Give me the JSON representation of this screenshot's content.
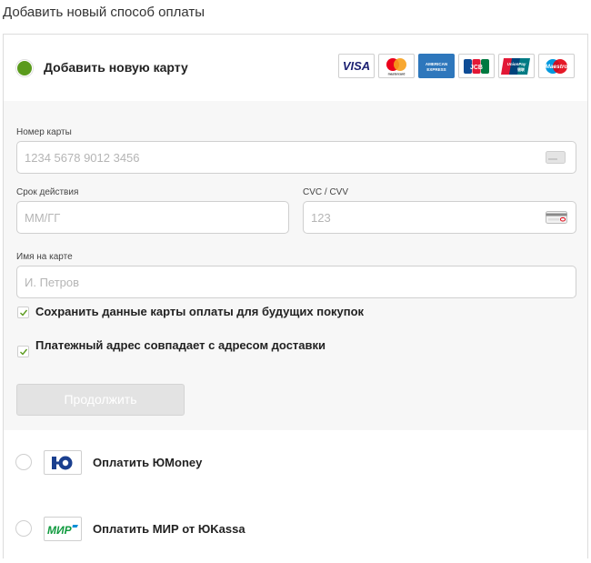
{
  "page": {
    "title": "Добавить новый способ оплаты"
  },
  "card_option": {
    "label": "Добавить новую карту",
    "brands": [
      {
        "name": "VISA",
        "icon": "visa-logo"
      },
      {
        "name": "mastercard",
        "icon": "mastercard-logo"
      },
      {
        "name": "AMERICAN EXPRESS",
        "icon": "amex-logo"
      },
      {
        "name": "JCB",
        "icon": "jcb-logo"
      },
      {
        "name": "UnionPay 银联",
        "icon": "unionpay-logo"
      },
      {
        "name": "Maestro",
        "icon": "maestro-logo"
      }
    ],
    "accent_color": "#5a9a1c"
  },
  "form": {
    "card_number": {
      "label": "Номер карты",
      "placeholder": "1234 5678 9012 3456"
    },
    "expiry": {
      "label": "Срок действия",
      "placeholder": "ММ/ГГ"
    },
    "cvc": {
      "label": "CVC / CVV",
      "placeholder": "123"
    },
    "holder": {
      "label": "Имя на карте",
      "placeholder": "И. Петров"
    },
    "save_card": {
      "label": "Сохранить данные карты оплаты для будущих покупок",
      "checked": true
    },
    "same_address": {
      "label": "Платежный адрес совпадает с адресом доставки",
      "checked": true
    },
    "continue_label": "Продолжить"
  },
  "other_options": [
    {
      "label": "Оплатить ЮMoney",
      "logo_text": "Ю",
      "icon": "yumoney-logo"
    },
    {
      "label": "Оплатить МИР от ЮKassa",
      "logo_text": "МИР",
      "icon": "mir-logo"
    }
  ]
}
